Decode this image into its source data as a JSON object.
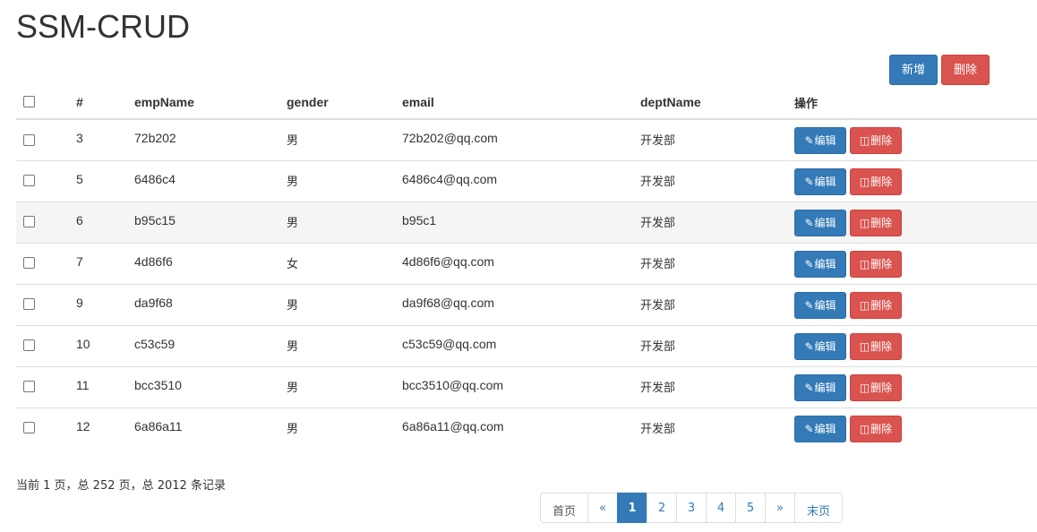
{
  "page": {
    "title": "SSM-CRUD"
  },
  "toolbar": {
    "add_label": "新增",
    "delete_label": "删除"
  },
  "table": {
    "headers": [
      "#",
      "empName",
      "gender",
      "email",
      "deptName",
      "操作"
    ],
    "rows": [
      {
        "id": "3",
        "empName": "72b202",
        "gender": "男",
        "email": "72b202@qq.com",
        "deptName": "开发部"
      },
      {
        "id": "5",
        "empName": "6486c4",
        "gender": "男",
        "email": "6486c4@qq.com",
        "deptName": "开发部"
      },
      {
        "id": "6",
        "empName": "b95c15",
        "gender": "男",
        "email": "b95c1",
        "deptName": "开发部"
      },
      {
        "id": "7",
        "empName": "4d86f6",
        "gender": "女",
        "email": "4d86f6@qq.com",
        "deptName": "开发部"
      },
      {
        "id": "9",
        "empName": "da9f68",
        "gender": "男",
        "email": "da9f68@qq.com",
        "deptName": "开发部"
      },
      {
        "id": "10",
        "empName": "c53c59",
        "gender": "男",
        "email": "c53c59@qq.com",
        "deptName": "开发部"
      },
      {
        "id": "11",
        "empName": "bcc3510",
        "gender": "男",
        "email": "bcc3510@qq.com",
        "deptName": "开发部"
      },
      {
        "id": "12",
        "empName": "6a86a11",
        "gender": "男",
        "email": "6a86a11@qq.com",
        "deptName": "开发部"
      }
    ],
    "edit_label": "编辑",
    "delete_label": "删除",
    "edit_icon": "pencil-icon",
    "delete_icon": "trash-icon"
  },
  "pagination": {
    "info": "当前 1 页，总 252 页，总 2012 条记录",
    "first": "首页",
    "prev": "«",
    "pages": [
      "1",
      "2",
      "3",
      "4",
      "5"
    ],
    "current": "1",
    "next": "»",
    "last": "末页"
  },
  "colors": {
    "primary": "#337ab7",
    "danger": "#d9534f",
    "stripe": "#f5f5f5",
    "border": "#dddddd"
  }
}
